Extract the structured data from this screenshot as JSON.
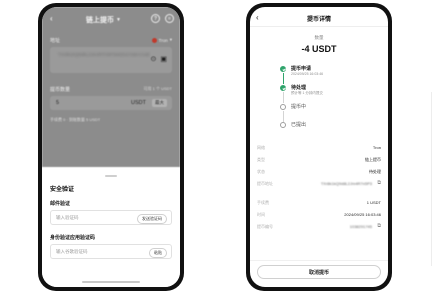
{
  "left_screen": {
    "title": "链上提币",
    "back_icon": "back-arrow-icon",
    "address_label": "地址",
    "network": "Tron",
    "address_value": "TXr8k1kQ9d8L2Jm4R7n5P3w6Zx2Ya9cV1sB",
    "amount_label": "提币数量",
    "available": "可用 1 个 USDT",
    "amount_value": "5",
    "amount_unit": "USDT",
    "max_label": "最大",
    "fee_text": "手续费 0 · 到账数量 5 USDT",
    "sheet": {
      "title": "安全验证",
      "email_label": "邮件验证",
      "email_placeholder": "输入验证码",
      "email_send": "发送验证码",
      "auth_label": "身份验证应用验证码",
      "auth_placeholder": "输入谷歌验证码",
      "auth_paste": "粘贴"
    }
  },
  "right_screen": {
    "title": "提币详情",
    "amount_label": "数量",
    "amount": "-4 USDT",
    "steps": [
      {
        "title": "提币申请",
        "sub": "2024/09/25 16:03:46",
        "status": "done"
      },
      {
        "title": "待处理",
        "sub": "预计等 1 分钟内提交",
        "status": "done"
      },
      {
        "title": "提币中",
        "sub": "",
        "status": "pending"
      },
      {
        "title": "已提出",
        "sub": "",
        "status": "pending"
      }
    ],
    "details": [
      {
        "key": "网络",
        "value": "Tron"
      },
      {
        "key": "类型",
        "value": "链上提币"
      },
      {
        "key": "状态",
        "value": "待处理"
      },
      {
        "key": "提币地址",
        "value": "TXr8k1kQ9d8L2Jm4R7n5P3",
        "blur": true,
        "copy": true
      },
      {
        "key": "手续费",
        "value": "1 USDT"
      },
      {
        "key": "时间",
        "value": "2024/09/25 16:03:46"
      },
      {
        "key": "提币编号",
        "value": "1038291745",
        "blur": true,
        "copy": true
      }
    ],
    "cancel_button": "取消提币"
  },
  "colors": {
    "accent_green": "#30a46c",
    "overlay": "#8c8c8c",
    "network_dot": "#c0392b"
  }
}
